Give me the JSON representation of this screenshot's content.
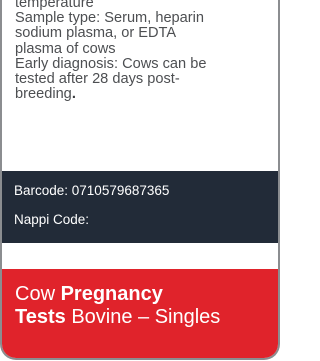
{
  "description": {
    "lines": [
      "temperature",
      "Sample type: Serum, heparin",
      "sodium plasma, or EDTA",
      "plasma of cows",
      "Early diagnosis: Cows can be",
      "tested after 28 days post-"
    ],
    "last_line_text": "breeding",
    "last_line_period": "."
  },
  "info": {
    "barcode": "Barcode: 0710579687365",
    "nappi": "Nappi Code:"
  },
  "title": {
    "line1_regular": "Cow ",
    "line1_bold": "Pregnancy",
    "line2_bold": "Tests",
    "line2_regular": " Bovine – Singles"
  },
  "colors": {
    "info_background": "#222b38",
    "title_background": "#e0232b",
    "border": "#8b8d90"
  }
}
